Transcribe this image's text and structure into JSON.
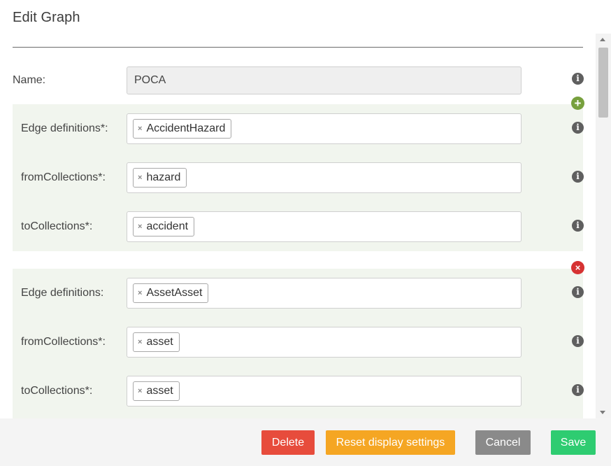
{
  "modal": {
    "title": "Edit Graph"
  },
  "name_field": {
    "label": "Name:",
    "value": "POCA"
  },
  "sections": [
    {
      "edge_label": "Edge definitions*:",
      "edge_tag": "AccidentHazard",
      "from_label": "fromCollections*:",
      "from_tag": "hazard",
      "to_label": "toCollections*:",
      "to_tag": "accident",
      "action_icon": "add-icon"
    },
    {
      "edge_label": "Edge definitions:",
      "edge_tag": "AssetAsset",
      "from_label": "fromCollections*:",
      "from_tag": "asset",
      "to_label": "toCollections*:",
      "to_tag": "asset",
      "action_icon": "remove-icon"
    }
  ],
  "icons": {
    "info": "i",
    "add": "+",
    "remove": "×",
    "tag_remove": "×"
  },
  "buttons": {
    "delete": "Delete",
    "reset": "Reset display settings",
    "cancel": "Cancel",
    "save": "Save"
  },
  "colors": {
    "delete": "#e74c3c",
    "reset": "#f5a623",
    "cancel": "#8a8a8a",
    "save": "#2ecc71",
    "section_bg": "#f1f5ee",
    "add": "#77a03d",
    "remove": "#d63232"
  }
}
